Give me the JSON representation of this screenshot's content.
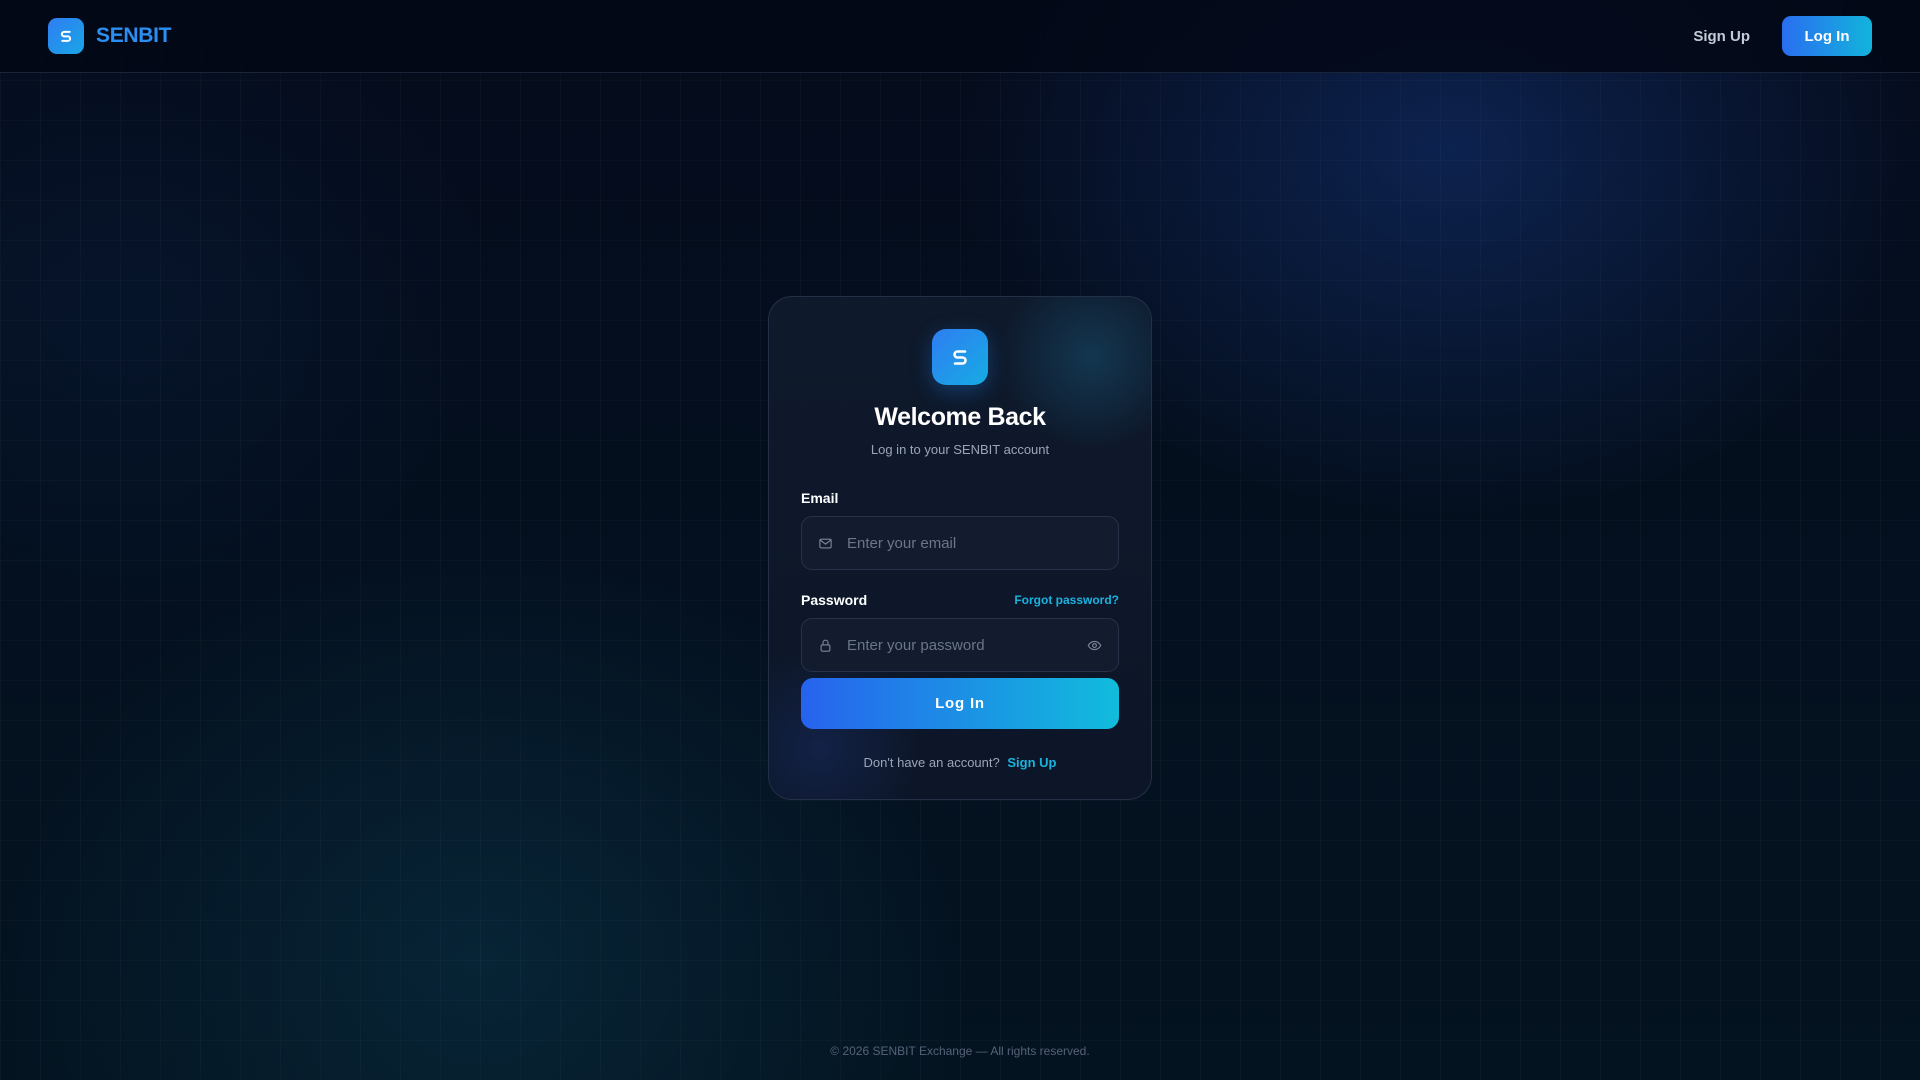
{
  "header": {
    "brand_name": "SENBIT",
    "signup_label": "Sign Up",
    "login_label": "Log In"
  },
  "card": {
    "title": "Welcome Back",
    "subtitle": "Log in to your SENBIT account",
    "email": {
      "label": "Email",
      "value": "",
      "placeholder": "Enter your email"
    },
    "password": {
      "label": "Password",
      "value": "",
      "placeholder": "Enter your password",
      "forgot_label": "Forgot password?"
    },
    "submit_label": "Log In",
    "signup_prompt": "Don't have an account?",
    "signup_link": "Sign Up"
  },
  "footer": {
    "copyright": "© 2026 SENBIT Exchange — All rights reserved."
  },
  "icons": {
    "logo": "s-logo-icon",
    "email": "mail-icon",
    "password": "lock-icon",
    "toggle": "eye-icon"
  },
  "colors": {
    "accent": "#1ab3e0",
    "brand": "#2b8ff2",
    "gradient_start": "#2763ee",
    "gradient_end": "#11bcdc",
    "background": "#040a18"
  }
}
